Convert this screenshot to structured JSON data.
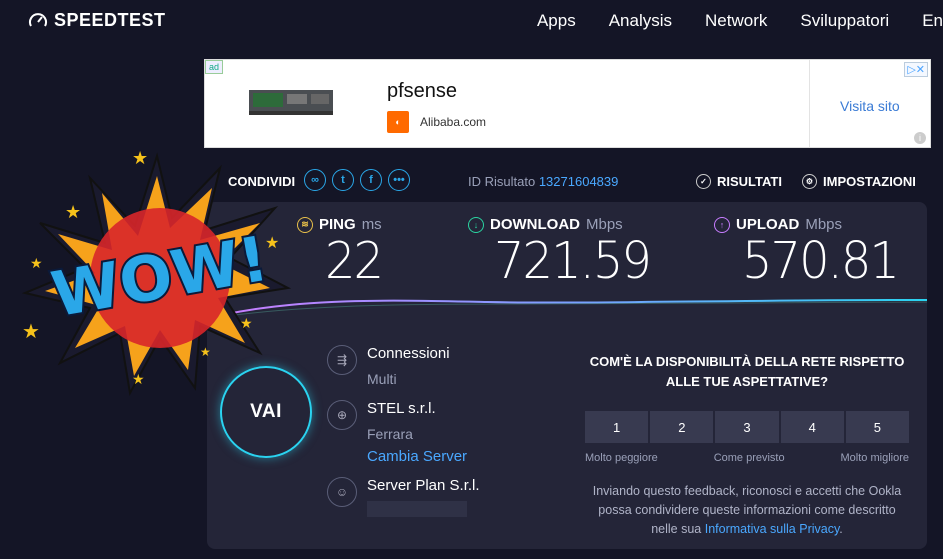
{
  "header": {
    "logo": "SPEEDTEST",
    "nav": [
      "Apps",
      "Analysis",
      "Network",
      "Sviluppatori",
      "En"
    ]
  },
  "ad": {
    "badge": "ad",
    "title": "pfsense",
    "domain": "Alibaba.com",
    "cta": "Visita sito"
  },
  "share": {
    "label": "CONDIVIDI",
    "result_id_label": "ID Risultato",
    "result_id": "13271604839",
    "results_label": "RISULTATI",
    "settings_label": "IMPOSTAZIONI"
  },
  "metrics": {
    "ping": {
      "label": "PING",
      "unit": "ms",
      "value": "22"
    },
    "download": {
      "label": "DOWNLOAD",
      "unit": "Mbps",
      "value": "721.59"
    },
    "upload": {
      "label": "UPLOAD",
      "unit": "Mbps",
      "value": "570.81"
    }
  },
  "go_label": "VAI",
  "connection": {
    "title": "Connessioni",
    "sub": "Multi"
  },
  "isp": {
    "title": "STEL s.r.l.",
    "sub": "Ferrara",
    "link": "Cambia Server"
  },
  "host": {
    "title": "Server Plan S.r.l."
  },
  "survey": {
    "question": "COM'È LA DISPONIBILITÀ DELLA RETE RISPETTO ALLE TUE ASPETTATIVE?",
    "options": [
      "1",
      "2",
      "3",
      "4",
      "5"
    ],
    "low": "Molto peggiore",
    "mid": "Come previsto",
    "high": "Molto migliore",
    "notice": "Inviando questo feedback, riconosci e accetti che Ookla possa condividere queste informazioni come descritto nelle sua",
    "notice_link": "Informativa sulla Privacy",
    "notice_end": "."
  },
  "sticker": {
    "text": "WOW!"
  },
  "colors": {
    "accent": "#2ad3f0",
    "link": "#4aa8ff",
    "ping": "#e8c04a",
    "download": "#2ad3a0",
    "upload": "#c77dff"
  }
}
